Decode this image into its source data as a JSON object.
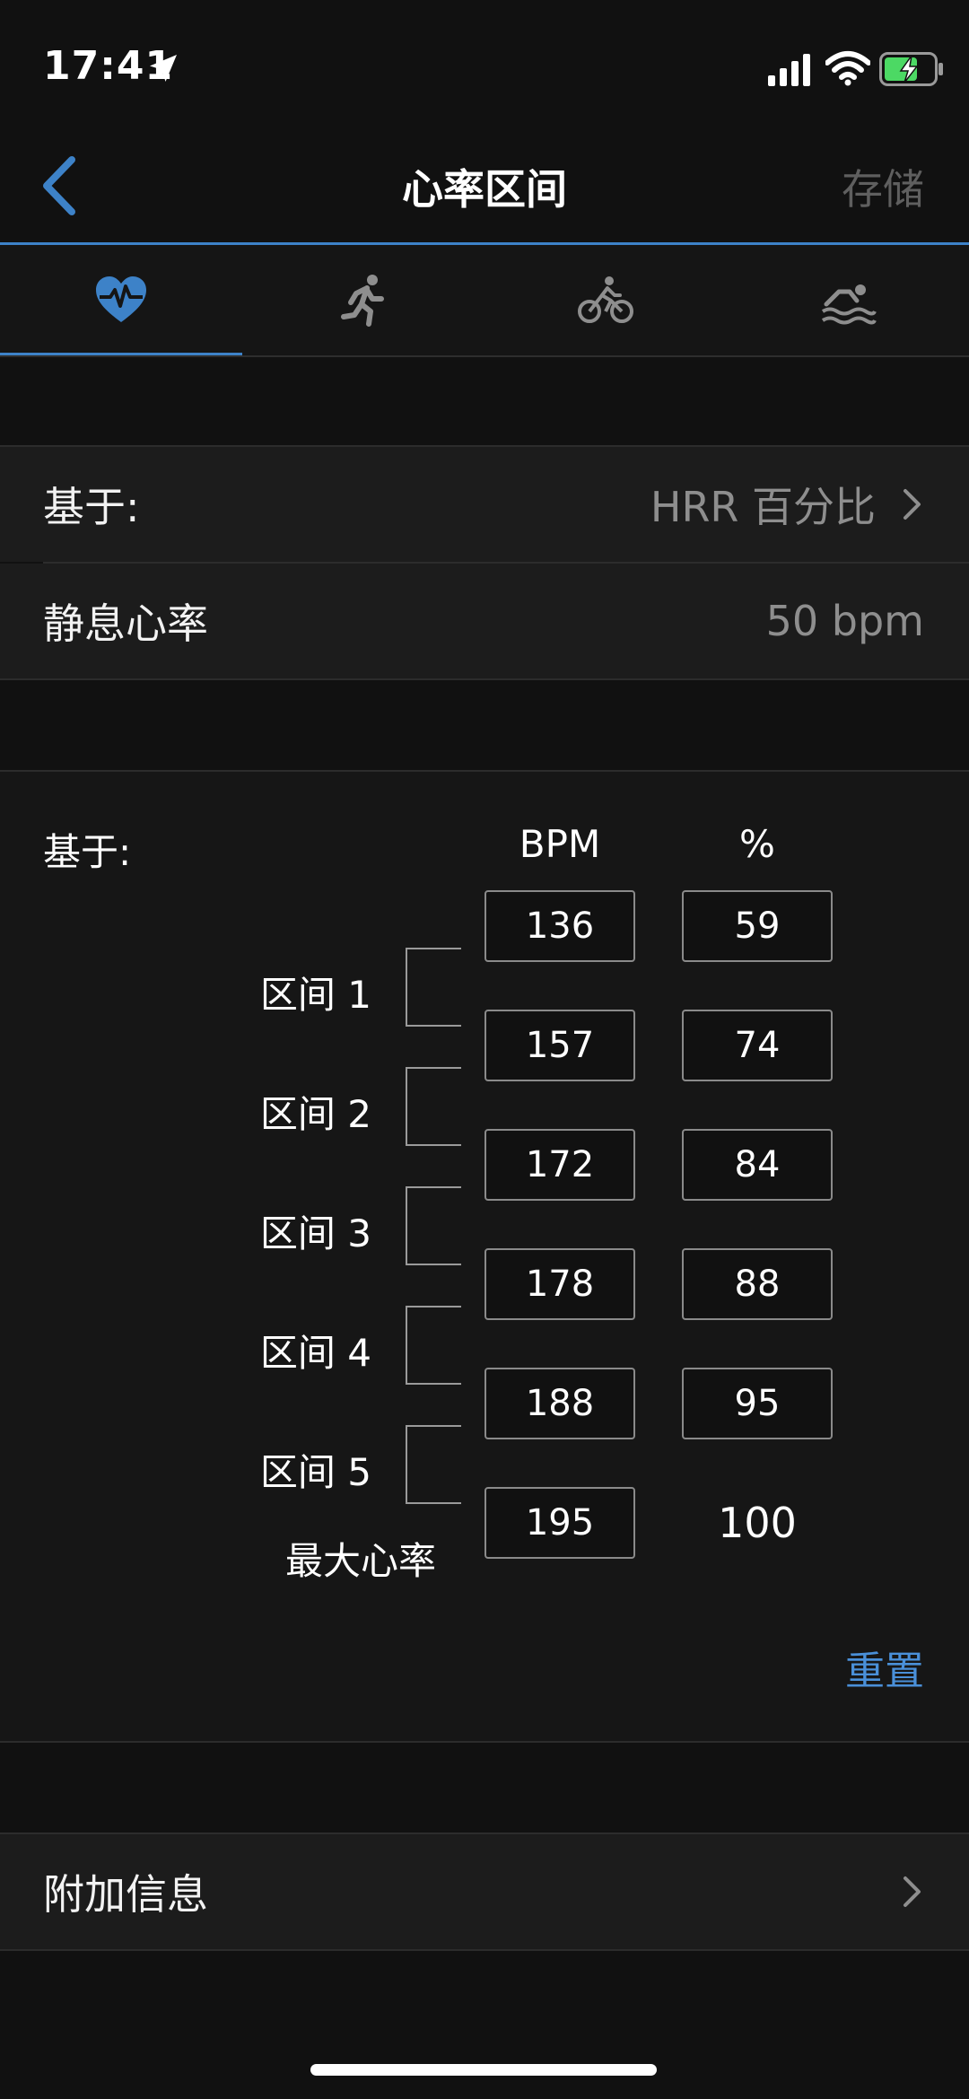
{
  "status_bar": {
    "time": "17:41"
  },
  "nav": {
    "title": "心率区间",
    "save_label": "存储"
  },
  "tabs": [
    {
      "name": "heart-rate",
      "icon": "heart-pulse-icon",
      "active": true
    },
    {
      "name": "running",
      "icon": "runner-icon",
      "active": false
    },
    {
      "name": "cycling",
      "icon": "bicycle-icon",
      "active": false
    },
    {
      "name": "swimming",
      "icon": "swimmer-icon",
      "active": false
    }
  ],
  "settings": {
    "based_on_label": "基于:",
    "based_on_value": "HRR 百分比",
    "resting_hr_label": "静息心率",
    "resting_hr_value": "50 bpm"
  },
  "zones": {
    "based_on_label": "基于:",
    "bpm_header": "BPM",
    "pct_header": "%",
    "labels": [
      "区间 1",
      "区间 2",
      "区间 3",
      "区间 4",
      "区间 5"
    ],
    "max_label": "最大心率",
    "bpm_values": [
      "136",
      "157",
      "172",
      "178",
      "188",
      "195"
    ],
    "pct_values": [
      "59",
      "74",
      "84",
      "88",
      "95"
    ],
    "max_pct": "100",
    "reset_label": "重置"
  },
  "extra": {
    "label": "附加信息"
  },
  "colors": {
    "accent": "#3d82c8",
    "link": "#4a90d9",
    "background": "#111111"
  }
}
